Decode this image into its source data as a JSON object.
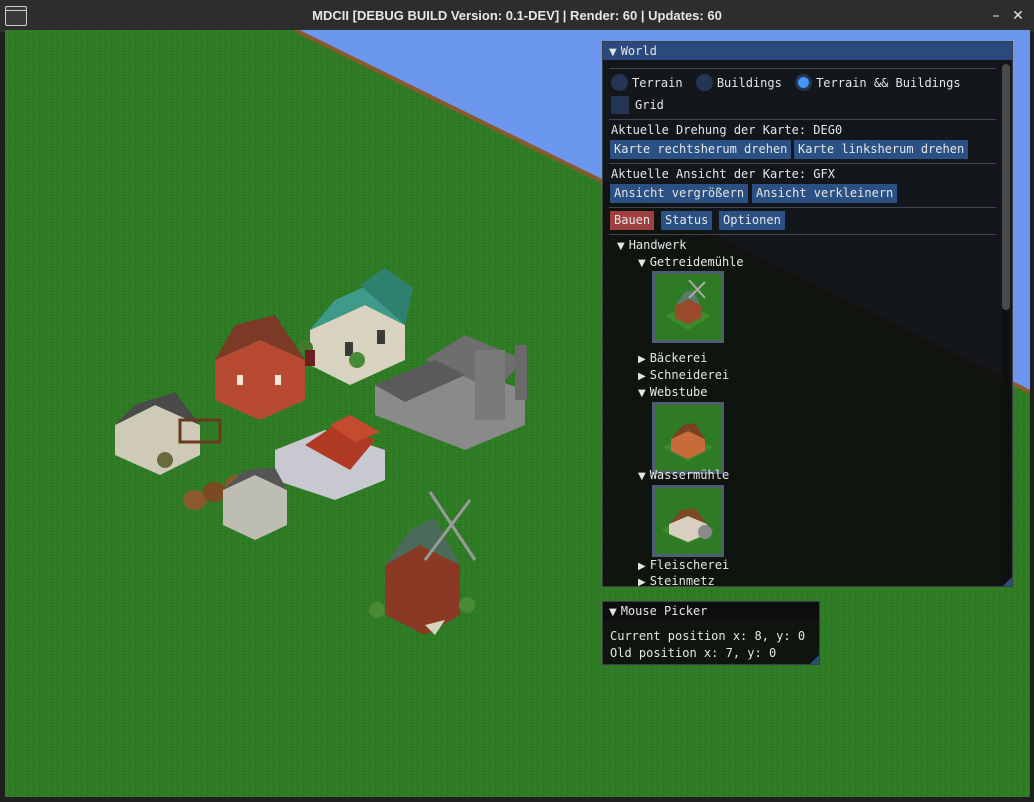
{
  "window": {
    "title": "MDCII [DEBUG BUILD Version: 0.1-DEV]   |   Render: 60   |   Updates: 60",
    "minimize_icon": "minimize-icon",
    "close_icon": "close-icon"
  },
  "world_panel": {
    "title": "World",
    "view_mode": {
      "options": [
        "Terrain",
        "Buildings",
        "Terrain && Buildings"
      ],
      "selected": "Terrain && Buildings"
    },
    "grid": {
      "label": "Grid",
      "checked": false
    },
    "rotation_label": "Aktuelle Drehung der Karte: DEG0",
    "rotate_right_label": "Karte rechtsherum drehen",
    "rotate_left_label": "Karte linksherum drehen",
    "zoom_label": "Aktuelle Ansicht der Karte: GFX",
    "zoom_in_label": "Ansicht vergrößern",
    "zoom_out_label": "Ansicht verkleinern",
    "tabs": [
      "Bauen",
      "Status",
      "Optionen"
    ],
    "active_tab": "Bauen",
    "tree": {
      "category": "Handwerk",
      "items": [
        {
          "label": "Getreidemühle",
          "expanded": true,
          "icon": "windmill-building-icon"
        },
        {
          "label": "Bäckerei",
          "expanded": false
        },
        {
          "label": "Schneiderei",
          "expanded": false
        },
        {
          "label": "Webstube",
          "expanded": true,
          "icon": "weaver-building-icon"
        },
        {
          "label": "Wassermühle",
          "expanded": true,
          "icon": "watermill-building-icon"
        },
        {
          "label": "Fleischerei",
          "expanded": false
        },
        {
          "label": "Steinmetz",
          "expanded": false
        }
      ]
    }
  },
  "mouse_picker": {
    "title": "Mouse Picker",
    "current_position": "Current position x: 8, y: 0",
    "old_position": "Old position x: 7, y: 0"
  },
  "colors": {
    "grass": "#2f7a24",
    "water": "#6b97ee",
    "panel_header": "#294a7a",
    "button": "#2a5084",
    "active_tab": "#a04040",
    "radio_active": "#4296fa"
  }
}
